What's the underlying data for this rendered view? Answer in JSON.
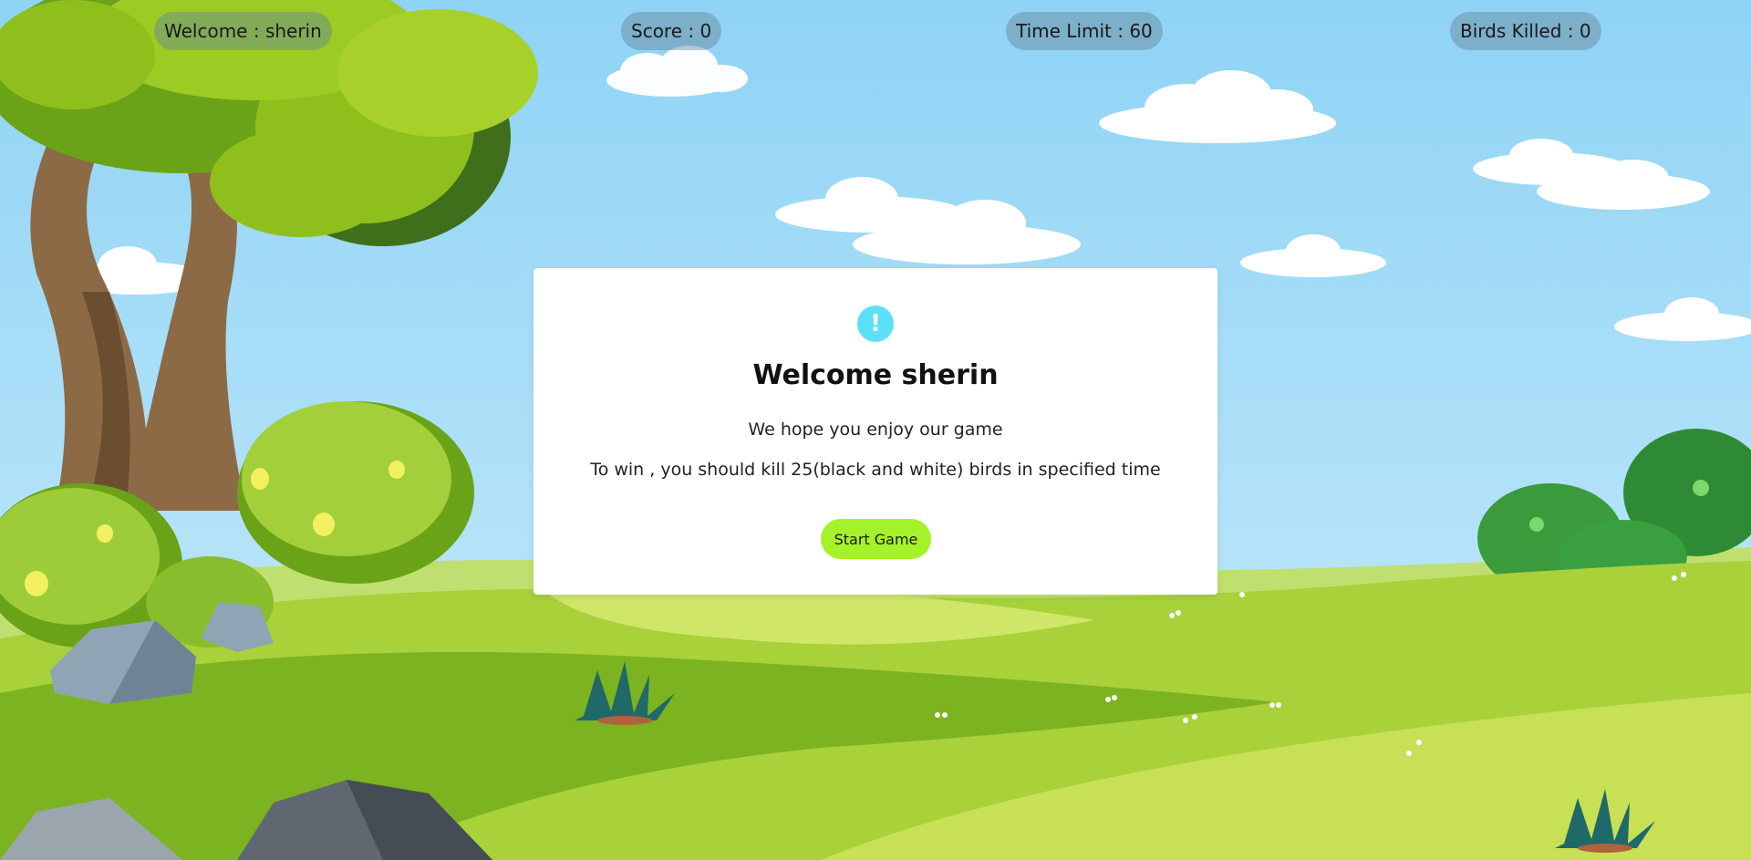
{
  "hud": {
    "welcome": "Welcome : sherin",
    "score": "Score : 0",
    "time_limit": "Time Limit : 60",
    "birds_killed": "Birds Killed : 0"
  },
  "modal": {
    "icon": "!",
    "icon_name": "exclamation-icon",
    "title": "Welcome sherin",
    "line1": "We hope you enjoy our game",
    "line2": "To win , you should kill 25(black and white) birds in specified time",
    "start_label": "Start Game"
  },
  "colors": {
    "sky": "#9fdcf6",
    "grass": "#a8d13a",
    "modal_bg": "#ffffff",
    "icon_accent": "#5ce0f7",
    "start_button": "#a5f22a",
    "hud_pill": "#6f8fa3"
  }
}
